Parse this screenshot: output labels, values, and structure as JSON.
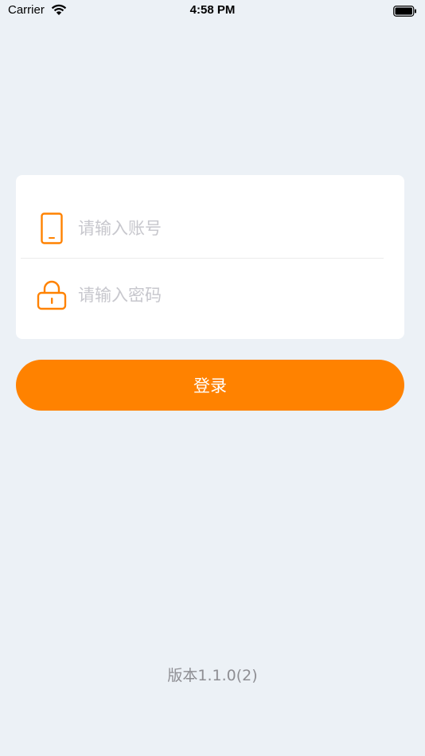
{
  "status_bar": {
    "carrier": "Carrier",
    "time": "4:58 PM",
    "wifi_icon": "wifi-icon",
    "battery_icon": "battery-icon"
  },
  "login_form": {
    "account": {
      "icon": "phone-icon",
      "placeholder": "请输入账号",
      "value": ""
    },
    "password": {
      "icon": "lock-icon",
      "placeholder": "请输入密码",
      "value": ""
    },
    "submit_label": "登录"
  },
  "footer": {
    "version": "版本1.1.0(2)"
  },
  "colors": {
    "accent": "#ff8200",
    "background": "#ecf1f6",
    "card": "#ffffff",
    "placeholder": "#c7c7cd",
    "version_text": "#8e8e93"
  }
}
